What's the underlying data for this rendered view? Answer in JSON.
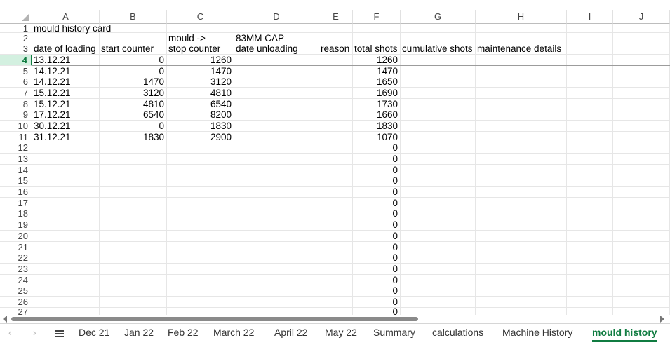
{
  "columns": [
    "A",
    "B",
    "C",
    "D",
    "E",
    "F",
    "G",
    "H",
    "I",
    "J"
  ],
  "selected_row": "4",
  "rows": [
    {
      "n": "1",
      "cells": [
        "mould history card",
        "",
        "",
        "",
        "",
        "",
        "",
        "",
        "",
        ""
      ]
    },
    {
      "n": "2",
      "cells": [
        "",
        "",
        "mould ->",
        "83MM CAP",
        "",
        "",
        "",
        "",
        "",
        ""
      ]
    },
    {
      "n": "3",
      "cells": [
        "date of loading",
        "start counter",
        "stop counter",
        "date unloading",
        "reason",
        "total shots",
        "cumulative shots",
        "maintenance details",
        "",
        ""
      ]
    },
    {
      "n": "4",
      "cells": [
        "13.12.21",
        "0",
        "1260",
        "",
        "",
        "1260",
        "",
        "",
        "",
        ""
      ]
    },
    {
      "n": "5",
      "cells": [
        "14.12.21",
        "0",
        "1470",
        "",
        "",
        "1470",
        "",
        "",
        "",
        ""
      ]
    },
    {
      "n": "6",
      "cells": [
        "14.12.21",
        "1470",
        "3120",
        "",
        "",
        "1650",
        "",
        "",
        "",
        ""
      ]
    },
    {
      "n": "7",
      "cells": [
        "15.12.21",
        "3120",
        "4810",
        "",
        "",
        "1690",
        "",
        "",
        "",
        ""
      ]
    },
    {
      "n": "8",
      "cells": [
        "15.12.21",
        "4810",
        "6540",
        "",
        "",
        "1730",
        "",
        "",
        "",
        ""
      ]
    },
    {
      "n": "9",
      "cells": [
        "17.12.21",
        "6540",
        "8200",
        "",
        "",
        "1660",
        "",
        "",
        "",
        ""
      ]
    },
    {
      "n": "10",
      "cells": [
        "30.12.21",
        "0",
        "1830",
        "",
        "",
        "1830",
        "",
        "",
        "",
        ""
      ]
    },
    {
      "n": "11",
      "cells": [
        "31.12.21",
        "1830",
        "2900",
        "",
        "",
        "1070",
        "",
        "",
        "",
        ""
      ]
    },
    {
      "n": "12",
      "cells": [
        "",
        "",
        "",
        "",
        "",
        "0",
        "",
        "",
        "",
        ""
      ]
    },
    {
      "n": "13",
      "cells": [
        "",
        "",
        "",
        "",
        "",
        "0",
        "",
        "",
        "",
        ""
      ]
    },
    {
      "n": "14",
      "cells": [
        "",
        "",
        "",
        "",
        "",
        "0",
        "",
        "",
        "",
        ""
      ]
    },
    {
      "n": "15",
      "cells": [
        "",
        "",
        "",
        "",
        "",
        "0",
        "",
        "",
        "",
        ""
      ]
    },
    {
      "n": "16",
      "cells": [
        "",
        "",
        "",
        "",
        "",
        "0",
        "",
        "",
        "",
        ""
      ]
    },
    {
      "n": "17",
      "cells": [
        "",
        "",
        "",
        "",
        "",
        "0",
        "",
        "",
        "",
        ""
      ]
    },
    {
      "n": "18",
      "cells": [
        "",
        "",
        "",
        "",
        "",
        "0",
        "",
        "",
        "",
        ""
      ]
    },
    {
      "n": "19",
      "cells": [
        "",
        "",
        "",
        "",
        "",
        "0",
        "",
        "",
        "",
        ""
      ]
    },
    {
      "n": "20",
      "cells": [
        "",
        "",
        "",
        "",
        "",
        "0",
        "",
        "",
        "",
        ""
      ]
    },
    {
      "n": "21",
      "cells": [
        "",
        "",
        "",
        "",
        "",
        "0",
        "",
        "",
        "",
        ""
      ]
    },
    {
      "n": "22",
      "cells": [
        "",
        "",
        "",
        "",
        "",
        "0",
        "",
        "",
        "",
        ""
      ]
    },
    {
      "n": "23",
      "cells": [
        "",
        "",
        "",
        "",
        "",
        "0",
        "",
        "",
        "",
        ""
      ]
    },
    {
      "n": "24",
      "cells": [
        "",
        "",
        "",
        "",
        "",
        "0",
        "",
        "",
        "",
        ""
      ]
    },
    {
      "n": "25",
      "cells": [
        "",
        "",
        "",
        "",
        "",
        "0",
        "",
        "",
        "",
        ""
      ]
    },
    {
      "n": "26",
      "cells": [
        "",
        "",
        "",
        "",
        "",
        "0",
        "",
        "",
        "",
        ""
      ]
    },
    {
      "n": "27",
      "cells": [
        "",
        "",
        "",
        "",
        "",
        "0",
        "",
        "",
        "",
        ""
      ]
    }
  ],
  "tabs": [
    "Dec 21",
    "Jan 22",
    "Feb 22",
    "March 22",
    "April 22",
    "May 22",
    "Summary",
    "calculations",
    "Machine History",
    "mould history"
  ],
  "active_tab": "mould history",
  "icons": {
    "prev": "chevron-left-icon",
    "next": "chevron-right-icon",
    "all_sheets": "menu-icon",
    "select_all": "select-all-corner-icon"
  },
  "accent_color": "#107c41"
}
